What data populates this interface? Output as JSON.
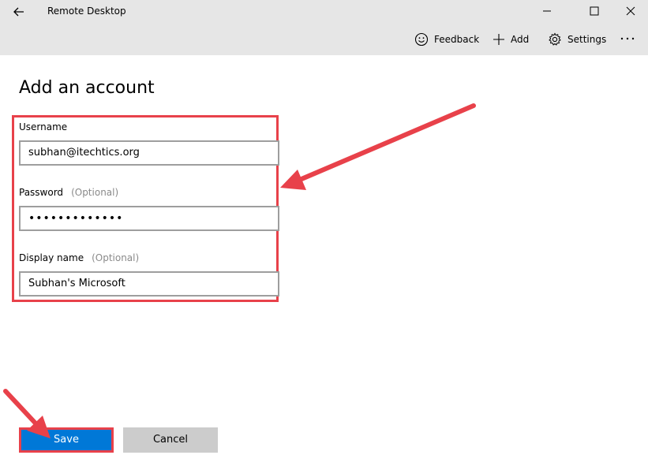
{
  "window": {
    "title": "Remote Desktop"
  },
  "commands": {
    "feedback": "Feedback",
    "add": "Add",
    "settings": "Settings",
    "more": "···"
  },
  "page": {
    "heading": "Add an account"
  },
  "form": {
    "username_label": "Username",
    "username_value": "subhan@itechtics.org",
    "password_label": "Password",
    "password_optional": "(Optional)",
    "password_value": "•••••••••••••",
    "display_label": "Display name",
    "display_optional": "(Optional)",
    "display_value": "Subhan's Microsoft"
  },
  "buttons": {
    "save": "Save",
    "cancel": "Cancel"
  },
  "colors": {
    "accent": "#0078d7",
    "annotation": "#e8414a",
    "topbar": "#e6e6e6"
  }
}
